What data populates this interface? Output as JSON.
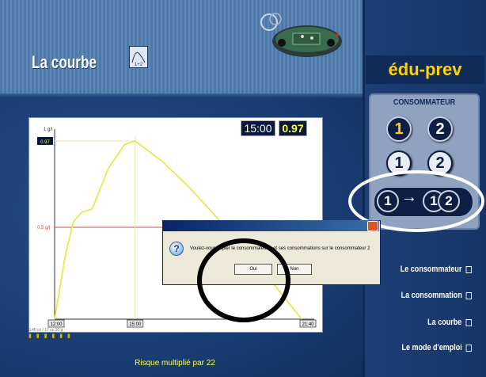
{
  "header": {
    "title": "La courbe",
    "icon_label": "1+2"
  },
  "brand": "édu-prev",
  "consumer_panel": {
    "title": "CONSOMMATEUR",
    "btn1": "1",
    "btn2": "2",
    "ghost1": "1",
    "ghost2": "2",
    "copy_from": "1",
    "copy_arrow": "→",
    "copy_to_a": "1",
    "copy_to_b": "2"
  },
  "menu": {
    "consumer": "Le consommateur",
    "consumption": "La consommation",
    "curve": "La courbe",
    "manual": "Le mode d'emploi"
  },
  "readout": {
    "time": "15:00",
    "value": "0.97"
  },
  "chart_data": {
    "type": "line",
    "y_top_label": "1 g/l",
    "y_peak_label": "0.97",
    "threshold_label": "0.5 g/l",
    "x_start_label": "12:00",
    "x_current_label": "15:00",
    "x_end_label": "21:40",
    "x_range": [
      12.0,
      21.67
    ],
    "y_range": [
      0,
      1.0
    ],
    "threshold": 0.5,
    "current_x": 15.0,
    "points": [
      {
        "x": 12.0,
        "y": 0.0
      },
      {
        "x": 12.4,
        "y": 0.35
      },
      {
        "x": 12.7,
        "y": 0.53
      },
      {
        "x": 13.0,
        "y": 0.58
      },
      {
        "x": 13.4,
        "y": 0.6
      },
      {
        "x": 14.0,
        "y": 0.82
      },
      {
        "x": 14.6,
        "y": 0.95
      },
      {
        "x": 15.0,
        "y": 0.97
      },
      {
        "x": 16.0,
        "y": 0.86
      },
      {
        "x": 17.0,
        "y": 0.72
      },
      {
        "x": 18.0,
        "y": 0.56
      },
      {
        "x": 19.0,
        "y": 0.4
      },
      {
        "x": 20.0,
        "y": 0.22
      },
      {
        "x": 21.2,
        "y": 0.0
      }
    ]
  },
  "dialog": {
    "message": "Voulez-vous copier le consommateur 1 et ses consommations sur le consommateur 2",
    "ok": "Oui",
    "no": "Non"
  },
  "legend_small": "0.40 cc / 17 cc 10 g",
  "risk_text": "Risque multiplié par 22",
  "colors": {
    "brand_yellow": "#ffd200",
    "curve": "#e5e84f",
    "threshold": "#e0403c",
    "panel_bg": "#17386c"
  }
}
